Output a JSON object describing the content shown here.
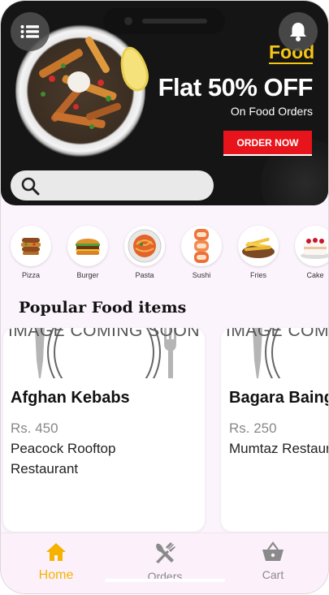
{
  "banner": {
    "tag": "Food",
    "title": "Flat 50% OFF",
    "subtitle": "On Food Orders",
    "cta": "ORDER NOW"
  },
  "header": {
    "menu_icon": "menu-icon",
    "bell_icon": "bell-icon"
  },
  "search": {
    "placeholder": "",
    "value": "",
    "icon": "search-icon"
  },
  "categories": [
    {
      "label": "Pizza"
    },
    {
      "label": "Burger"
    },
    {
      "label": "Pasta"
    },
    {
      "label": "Sushi"
    },
    {
      "label": "Fries"
    },
    {
      "label": "Cake"
    }
  ],
  "section": {
    "title": "Popular Food items"
  },
  "food_items": [
    {
      "image_text": "IMAGE COMING SOON",
      "name": "Afghan Kebabs",
      "price": "Rs. 450",
      "restaurant": "Peacock Rooftop Restaurant"
    },
    {
      "image_text": "IMAGE COMING SOON",
      "name": "Bagara Baingan",
      "price": "Rs. 250",
      "restaurant": "Mumtaz Restaurant"
    }
  ],
  "nav": {
    "items": [
      {
        "label": "Home",
        "icon": "home-icon",
        "active": true
      },
      {
        "label": "Orders",
        "icon": "fork-knife-icon",
        "active": false
      },
      {
        "label": "Cart",
        "icon": "basket-icon",
        "active": false
      }
    ]
  },
  "colors": {
    "accent": "#f5b300",
    "promo_red": "#e8141b",
    "promo_yellow": "#f5c518",
    "inactive_nav": "#8a8a8a",
    "background": "#fcf4fc"
  }
}
